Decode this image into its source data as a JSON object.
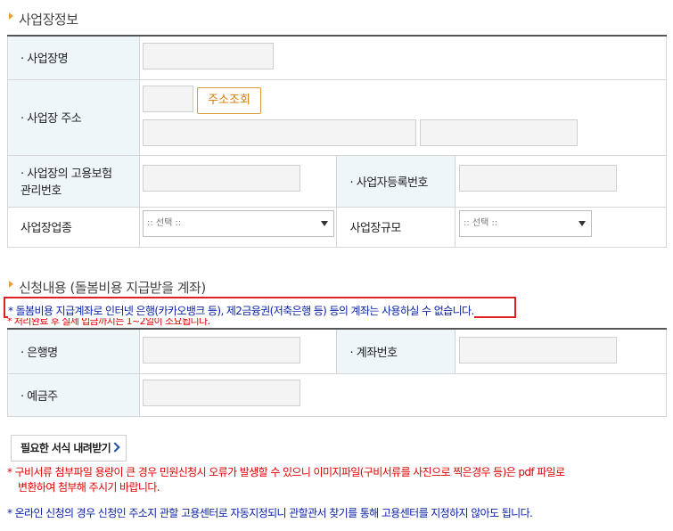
{
  "section1": {
    "title": "사업장정보",
    "name_label": "· 사업장명",
    "address_label": "· 사업장 주소",
    "address_button": "주소조회",
    "insurance_label_line1": "· 사업장의 고용보험",
    "insurance_label_line2": "관리번호",
    "biz_reg_label": "· 사업자등록번호",
    "industry_label": "사업장업종",
    "industry_select": ":: 선택 ::",
    "size_label": "사업장규모",
    "size_select": ":: 선택 ::"
  },
  "section2": {
    "title": "신청내용 (돌봄비용 지급받을 계좌)",
    "notice_blue": "* 돌봄비용 지급계좌로 인터넷 은행(카카오뱅크 등), 제2금융권(저축은행 등) 등의 계좌는 사용하실 수 없습니다.",
    "notice_red": "* 처리완료 후 실제 입금까지는 1~2일이 소요됩니다.",
    "bank_label": "· 은행명",
    "account_label": "· 계좌번호",
    "holder_label": "· 예금주"
  },
  "download_button": "필요한 서식 내려받기",
  "footer": {
    "red_note_line1": "* 구비서류 첨부파일 용량이 큰 경우 민원신청시 오류가 발생할 수 있으니 이미지파일(구비서류를 사진으로 찍은경우 등)은 pdf 파일로",
    "red_note_line2": "변환하여 첨부해 주시기 바랍니다.",
    "blue_note": "* 온라인 신청의 경우 신청인 주소지 관할 고용센터로 자동지정되니 관할관서 찾기를 통해 고용센터를 지정하지 않아도 됩니다."
  },
  "colors": {
    "label_bg": "#eef6fa",
    "marker": "#e8a13a",
    "notice_red": "#e00000",
    "notice_blue": "#0c23a8",
    "highlight_border": "#e02020",
    "button_accent": "#d57a00"
  }
}
